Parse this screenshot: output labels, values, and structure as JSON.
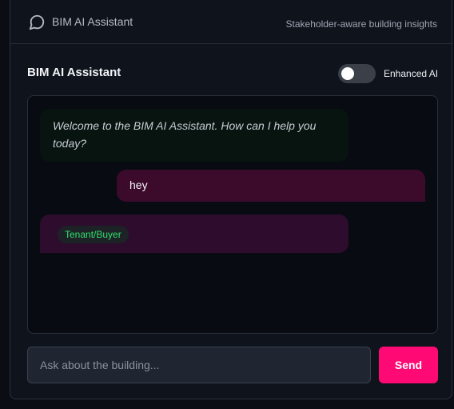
{
  "header": {
    "app_title": "BIM AI Assistant",
    "subtitle": "Stakeholder-aware building insights",
    "icon": "chat-bubble-icon"
  },
  "panel": {
    "heading": "BIM AI Assistant",
    "toggle": {
      "label": "Enhanced AI",
      "enabled": false
    }
  },
  "messages": [
    {
      "role": "assistant",
      "text": "Welcome to the BIM AI Assistant. How can I help you today?"
    },
    {
      "role": "user",
      "text": "hey"
    },
    {
      "role": "assistant",
      "badge": "Tenant/Buyer",
      "text": ""
    }
  ],
  "composer": {
    "placeholder": "Ask about the building...",
    "value": "",
    "send_label": "Send"
  },
  "colors": {
    "accent": "#ff0a74",
    "user_bubble": "#3c0b2c",
    "bot_bubble": "#2d0c2e",
    "badge_text": "#2ee06a"
  }
}
